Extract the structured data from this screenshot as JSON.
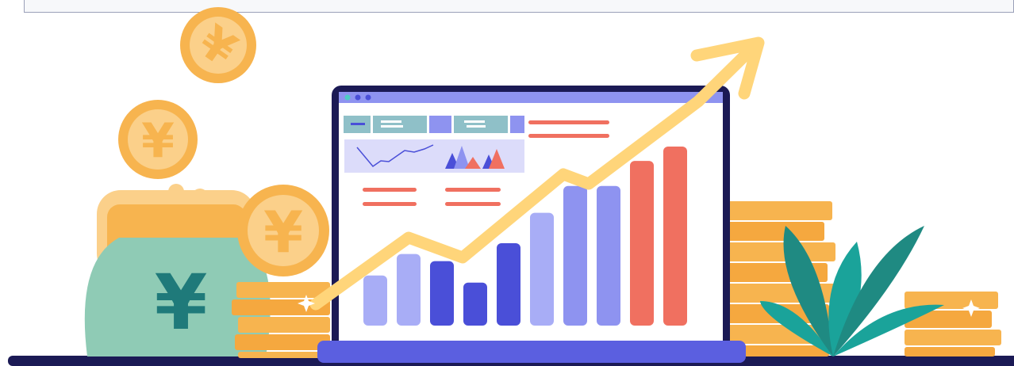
{
  "illustration": {
    "currency_symbol": "¥",
    "colors": {
      "coin": "#f7b44f",
      "coin_light": "#fbd08a",
      "purse": "#8fcbb5",
      "purse_symbol": "#1f7a7a",
      "arrow": "#ffd57a",
      "bar_light": "#a8adf6",
      "bar_mid": "#8e93f0",
      "bar_dark": "#4a4fd8",
      "bar_red": "#f07060",
      "laptop_frame": "#1b1a55",
      "laptop_base": "#5b5fe0",
      "plant": "#1f8a82",
      "ground": "#1b1a55"
    },
    "bar_levels": [
      0.28,
      0.4,
      0.36,
      0.24,
      0.46,
      0.63,
      0.78,
      0.78,
      0.92,
      1.0
    ],
    "bar_tones": [
      "light",
      "light",
      "dark",
      "dark",
      "dark",
      "light",
      "mid",
      "mid",
      "red",
      "red"
    ]
  }
}
